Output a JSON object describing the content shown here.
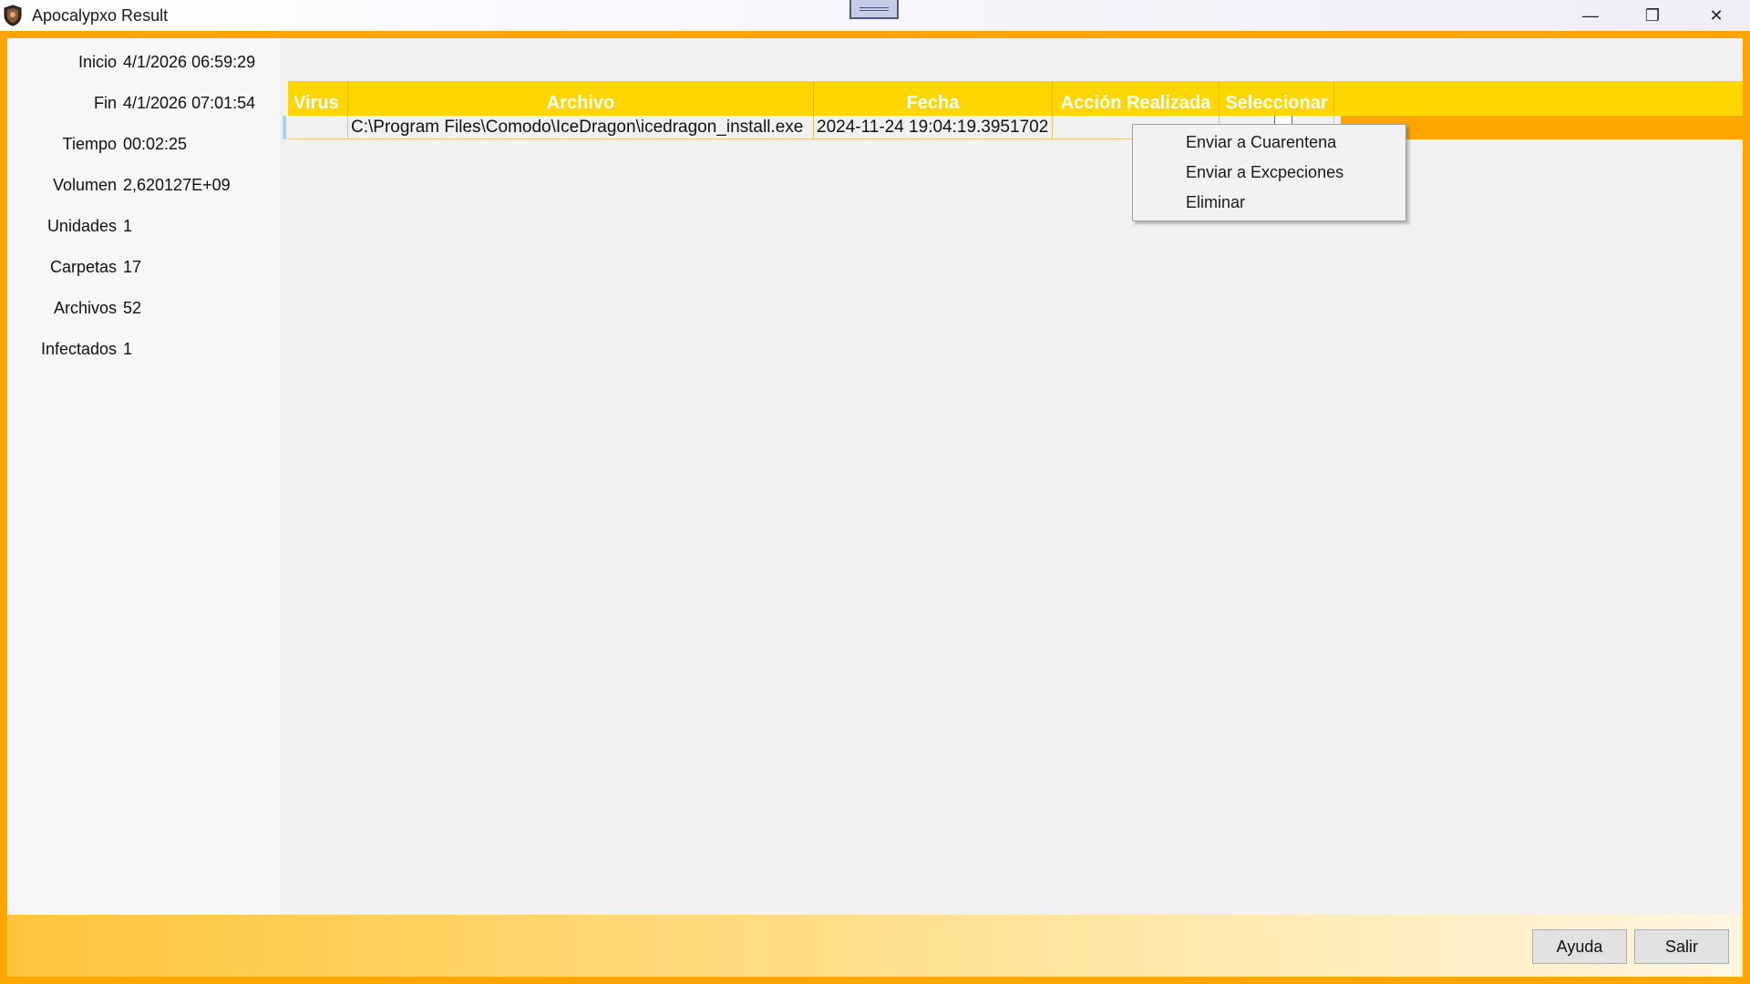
{
  "window": {
    "title": "Apocalypxo Result",
    "icon": "shield-logo-icon",
    "controls": {
      "minimize": "—",
      "maximize": "❐",
      "close": "✕"
    }
  },
  "summary": [
    {
      "label": "Inicio",
      "value": "4/1/2026 06:59:29"
    },
    {
      "label": "Fin",
      "value": "4/1/2026 07:01:54"
    },
    {
      "label": "Tiempo",
      "value": "00:02:25"
    },
    {
      "label": "Volumen",
      "value": "2,620127E+09"
    },
    {
      "label": "Unidades",
      "value": "1"
    },
    {
      "label": "Carpetas",
      "value": "17"
    },
    {
      "label": "Archivos",
      "value": "52"
    },
    {
      "label": "Infectados",
      "value": "1"
    }
  ],
  "grid": {
    "columns": [
      "Virus",
      "Archivo",
      "Fecha",
      "Acción Realizada",
      "Seleccionar"
    ],
    "rows": [
      {
        "virus": "",
        "archivo": "C:\\Program Files\\Comodo\\IceDragon\\icedragon_install.exe",
        "fecha": "2024-11-24 19:04:19.3951702",
        "accion": "",
        "seleccionar": false
      }
    ]
  },
  "context_menu": {
    "items": [
      "Enviar a Cuarentena",
      "Enviar a Excpeciones",
      "Eliminar"
    ]
  },
  "buttons": {
    "help": "Ayuda",
    "exit": "Salir"
  },
  "colors": {
    "frame": "#ffa500",
    "header": "#ffd700",
    "header_text": "#ffffff"
  }
}
